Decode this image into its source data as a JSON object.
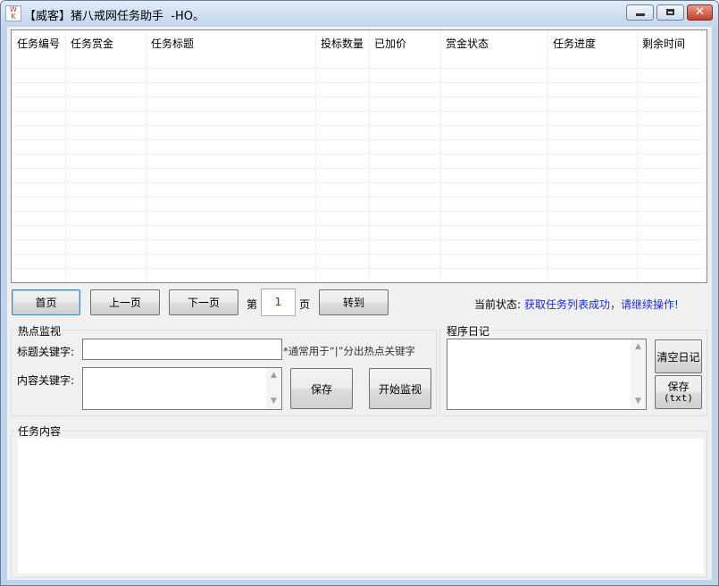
{
  "window": {
    "title": "【威客】猪八戒网任务助手  -HO。",
    "minimize_glyph": "minimize-icon",
    "maximize_glyph": "maximize-icon",
    "close_glyph": "close-icon",
    "close_char": "✕"
  },
  "table": {
    "columns": [
      "任务编号",
      "任务赏金",
      "任务标题",
      "投标数量",
      "已加价",
      "赏金状态",
      "任务进度",
      "剩余时间"
    ]
  },
  "pager": {
    "first": "首页",
    "prev": "上一页",
    "next": "下一页",
    "page_prefix": "第",
    "page_value": "1",
    "page_suffix": "页",
    "goto": "转到"
  },
  "status": {
    "label": "当前状态:",
    "value": "获取任务列表成功，请继续操作!"
  },
  "hotspot": {
    "title": "热点监视",
    "title_kw_label": "标题关键字:",
    "title_kw_value": "",
    "hint": "*通常用于“|”分出热点关键字",
    "content_kw_label": "内容关键字:",
    "content_kw_value": "",
    "save": "保存",
    "start": "开始监视"
  },
  "log": {
    "title": "程序日记",
    "content": "",
    "clear": "清空日记",
    "save_line1": "保存",
    "save_line2": "(txt)"
  },
  "task_content": {
    "title": "任务内容",
    "content": ""
  }
}
